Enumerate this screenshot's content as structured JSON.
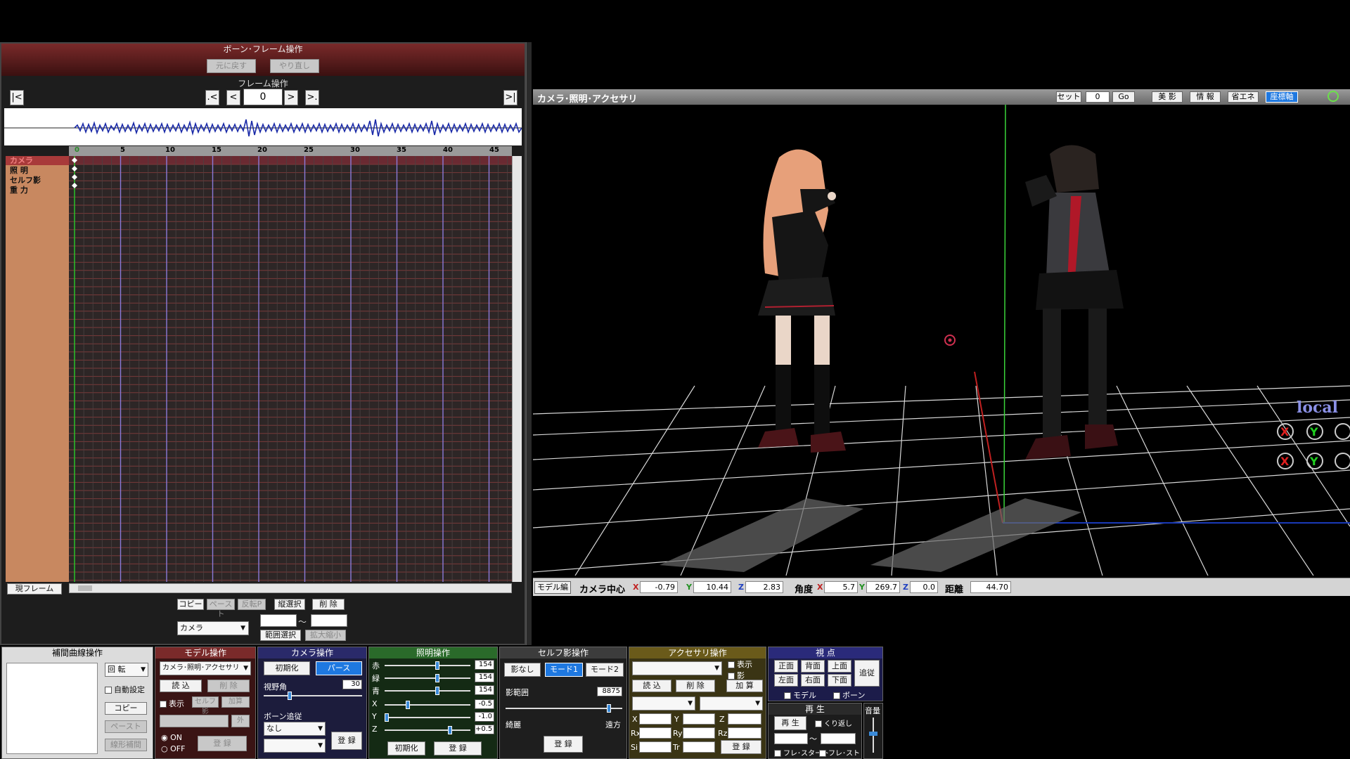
{
  "bone_frame": {
    "title": "ボーン･フレーム操作",
    "undo": "元に戻す",
    "redo": "やり直し"
  },
  "frame_ops": {
    "title": "フレーム操作",
    "first": "|<",
    "prev_key": ".<",
    "prev": "<",
    "current": "0",
    "next": ">",
    "next_key": ">.",
    "last": ">|"
  },
  "ruler": {
    "ticks": [
      "0",
      "5",
      "10",
      "15",
      "20",
      "25",
      "30",
      "35",
      "40",
      "45"
    ]
  },
  "rows": {
    "camera": "カメラ",
    "light": "照 明",
    "self_shadow": "セルフ影",
    "gravity": "重 力"
  },
  "timeline_bottom": {
    "current_frame": "現フレーム",
    "copy": "コピー",
    "paste": "ペースト",
    "reverse": "反転P",
    "vsel": "縦選択",
    "delete": "削 除",
    "target": "カメラ",
    "range_sep": "～",
    "range_select": "範囲選択",
    "zoom": "拡大縮小"
  },
  "viewport": {
    "title": "カメラ･照明･アクセサリ",
    "set": "セット",
    "frame_input": "0",
    "go": "Go",
    "beauty_shadow": "美 影",
    "info": "情 報",
    "eco": "省エネ",
    "axes": "座標軸",
    "local_label": "local",
    "mode_button": "モデル編",
    "camera_center_label": "カメラ中心",
    "cam_x": "-0.79",
    "cam_y": "10.44",
    "cam_z": "2.83",
    "angle_label": "角度",
    "ang_x": "5.7",
    "ang_y": "269.7",
    "ang_z": "0.0",
    "distance_label": "距離",
    "distance": "44.70",
    "axis_x": "X",
    "axis_y": "Y",
    "axis_z": "Z"
  },
  "interp": {
    "title": "補間曲線操作",
    "rotate": "回 転",
    "auto": "自動設定",
    "copy": "コピー",
    "paste": "ペースト",
    "linear": "線形補間"
  },
  "model_ops": {
    "title": "モデル操作",
    "selected": "カメラ･照明･アクセサリ",
    "load": "読 込",
    "delete": "削 除",
    "display": "表示",
    "self_shadow": "セルフ影",
    "add": "加算",
    "outer": "外",
    "on": "ON",
    "off": "OFF",
    "register": "登 録"
  },
  "camera_ops": {
    "title": "カメラ操作",
    "init": "初期化",
    "perspective": "パース",
    "fov_label": "視野角",
    "fov": "30",
    "bone_follow": "ボーン追従",
    "none": "なし",
    "register": "登 録"
  },
  "light_ops": {
    "title": "照明操作",
    "r": "赤",
    "g": "緑",
    "b": "青",
    "r_val": "154",
    "g_val": "154",
    "b_val": "154",
    "x": "X",
    "y": "Y",
    "z": "Z",
    "x_val": "-0.5",
    "y_val": "-1.0",
    "z_val": "+0.5",
    "init": "初期化",
    "register": "登 録"
  },
  "shadow_ops": {
    "title": "セルフ影操作",
    "none": "影なし",
    "mode1": "モード1",
    "mode2": "モード2",
    "range_label": "影範囲",
    "range": "8875",
    "near": "綺麗",
    "far": "遠方",
    "register": "登 録"
  },
  "accessory_ops": {
    "title": "アクセサリ操作",
    "display": "表示",
    "shadow": "影",
    "load": "読 込",
    "delete": "削 除",
    "add": "加 算",
    "x": "X",
    "y": "Y",
    "z": "Z",
    "rx": "Rx",
    "ry": "Ry",
    "rz": "Rz",
    "si": "Si",
    "tr": "Tr",
    "register": "登 録"
  },
  "view_ops": {
    "title": "視 点",
    "front": "正面",
    "back": "背面",
    "top": "上面",
    "left": "左面",
    "right": "右面",
    "bottom": "下面",
    "follow": "追従",
    "model": "モデル",
    "bone": "ボーン"
  },
  "play_ops": {
    "title": "再 生",
    "play": "再 生",
    "repeat": "くり返し",
    "range_sep": "～",
    "frame_start": "フレ･スタート",
    "frame_stop": "フレ･ストップ",
    "volume": "音量"
  },
  "colors": {
    "accent_red": "#7a2a2a",
    "grid_bg": "#2d2626",
    "label_bg": "#c88860",
    "blue_button": "#1e78e0"
  }
}
